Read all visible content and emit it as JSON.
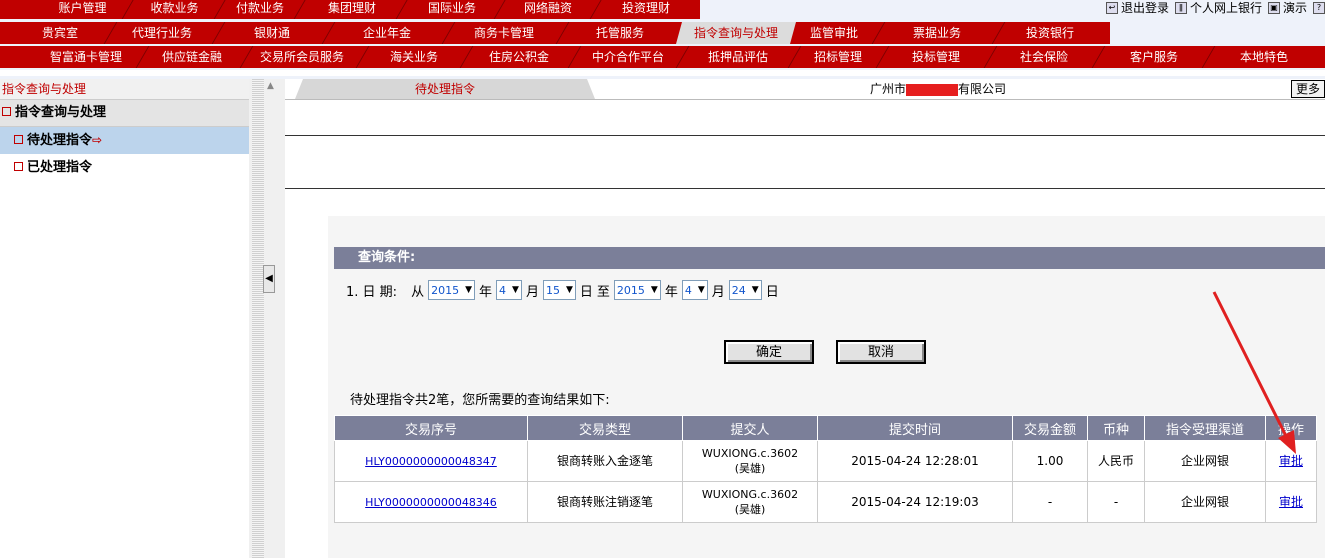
{
  "nav": {
    "row1": [
      "账户管理",
      "收款业务",
      "付款业务",
      "集团理财",
      "国际业务",
      "网络融资",
      "投资理财"
    ],
    "row2": [
      "贵宾室",
      "代理行业务",
      "银财通",
      "企业年金",
      "商务卡管理",
      "托管服务",
      "指令查询与处理",
      "监管审批",
      "票据业务",
      "投资银行"
    ],
    "row3": [
      "智富通卡管理",
      "供应链金融",
      "交易所会员服务",
      "海关业务",
      "住房公积金",
      "中介合作平台",
      "抵押品评估",
      "招标管理",
      "投标管理",
      "社会保险",
      "客户服务",
      "本地特色"
    ],
    "active_tab": "指令查询与处理"
  },
  "top_links": {
    "logout": "退出登录",
    "personal_bank": "个人网上银行",
    "demo": "演示"
  },
  "sidebar": {
    "header": "指令查询与处理",
    "title": "指令查询与处理",
    "items": [
      {
        "label": "待处理指令",
        "active": true
      },
      {
        "label": "已处理指令",
        "active": false
      }
    ]
  },
  "main": {
    "tab": "待处理指令",
    "company_prefix": "广州市",
    "company_suffix": "有限公司",
    "more_button": "更多"
  },
  "query": {
    "title": "查询条件:",
    "row_label": "1. 日 期:",
    "from": "从",
    "to": "至",
    "year_unit": "年",
    "month_unit": "月",
    "day_unit": "日",
    "start": {
      "year": "2015",
      "month": "4",
      "day": "15"
    },
    "end": {
      "year": "2015",
      "month": "4",
      "day": "24"
    },
    "confirm": "确定",
    "cancel": "取消"
  },
  "results": {
    "summary": "待处理指令共2笔，您所需要的查询结果如下:",
    "columns": [
      "交易序号",
      "交易类型",
      "提交人",
      "提交时间",
      "交易金额",
      "币种",
      "指令受理渠道",
      "操作"
    ],
    "rows": [
      {
        "seq": "HLY0000000000048347",
        "type": "银商转账入金逐笔",
        "submitter": "WUXIONG.c.3602",
        "submitter_name": "(吴雄)",
        "time": "2015-04-24 12:28:01",
        "amount": "1.00",
        "currency": "人民币",
        "channel": "企业网银",
        "action": "审批"
      },
      {
        "seq": "HLY0000000000048346",
        "type": "银商转账注销逐笔",
        "submitter": "WUXIONG.c.3602",
        "submitter_name": "(吴雄)",
        "time": "2015-04-24 12:19:03",
        "amount": "-",
        "currency": "-",
        "channel": "企业网银",
        "action": "审批"
      }
    ]
  },
  "colors": {
    "nav_red": "#c00000",
    "header_gray": "#7b7f99",
    "link_blue": "#0000cc"
  }
}
